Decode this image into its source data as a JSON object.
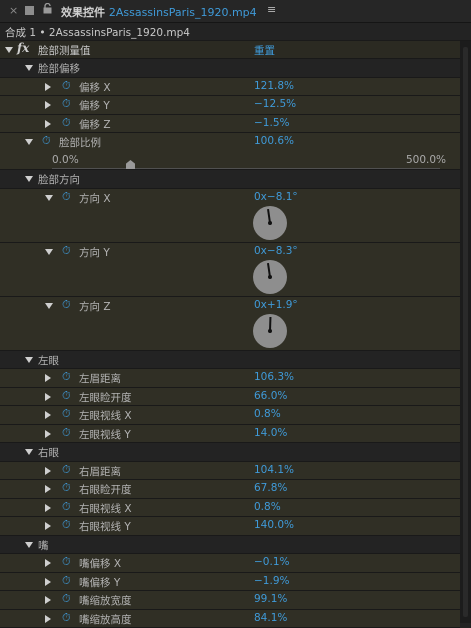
{
  "header": {
    "title_prefix": "效果控件",
    "file_name": "2AssassinsParis_1920.mp4",
    "close_glyph": "×",
    "lock_glyph": "🔒",
    "menu_glyph": "≡"
  },
  "breadcrumb": "合成 1 • 2AssassinsParis_1920.mp4",
  "effect": {
    "name": "脸部测量值",
    "reset": "重置"
  },
  "groups": {
    "face_offset": {
      "label": "脸部偏移",
      "items": [
        {
          "label": "偏移 X",
          "value": "121.8%"
        },
        {
          "label": "偏移 Y",
          "value": "−12.5%"
        },
        {
          "label": "偏移 Z",
          "value": "−1.5%"
        }
      ]
    },
    "face_scale": {
      "label": "脸部比例",
      "value": "100.6%",
      "min": "0.0%",
      "max": "500.0%",
      "fraction": 0.201
    },
    "face_orientation": {
      "label": "脸部方向",
      "items": [
        {
          "label": "方向 X",
          "value": "0x−8.1°",
          "angle": -8.1
        },
        {
          "label": "方向 Y",
          "value": "0x−8.3°",
          "angle": -8.3
        },
        {
          "label": "方向 Z",
          "value": "0x+1.9°",
          "angle": 1.9
        }
      ]
    },
    "left_eye": {
      "label": "左眼",
      "items": [
        {
          "label": "左眉距离",
          "value": "106.3%"
        },
        {
          "label": "左眼睑开度",
          "value": "66.0%"
        },
        {
          "label": "左眼视线 X",
          "value": "0.8%"
        },
        {
          "label": "左眼视线 Y",
          "value": "14.0%"
        }
      ]
    },
    "right_eye": {
      "label": "右眼",
      "items": [
        {
          "label": "右眉距离",
          "value": "104.1%"
        },
        {
          "label": "右眼睑开度",
          "value": "67.8%"
        },
        {
          "label": "右眼视线 X",
          "value": "0.8%"
        },
        {
          "label": "右眼视线 Y",
          "value": "140.0%"
        }
      ]
    },
    "mouth": {
      "label": "嘴",
      "items": [
        {
          "label": "嘴偏移 X",
          "value": "−0.1%"
        },
        {
          "label": "嘴偏移 Y",
          "value": "−1.9%"
        },
        {
          "label": "嘴缩放宽度",
          "value": "99.1%"
        },
        {
          "label": "嘴缩放高度",
          "value": "84.1%"
        }
      ]
    }
  },
  "icons": {
    "stopwatch": "stopwatch-icon",
    "expand": "disclosure-triangle-icon"
  },
  "colors": {
    "value_blue": "#3f9ad8",
    "row_olive": "#302f25",
    "panel_bg": "#232323"
  }
}
